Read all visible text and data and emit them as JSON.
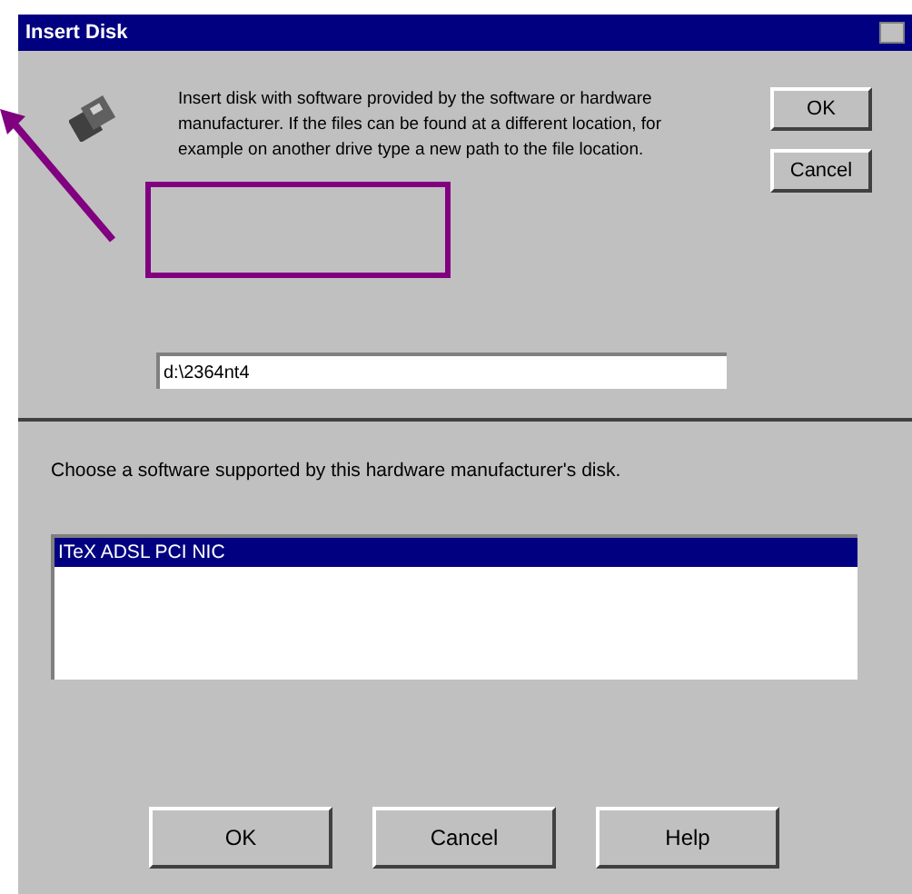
{
  "window": {
    "title": "Insert Disk"
  },
  "message": "Insert disk with software provided by the software or hardware manufacturer. If the files can be found at a different location, for example on another drive type a new path to the file location.",
  "side_buttons": [
    "OK",
    "Cancel"
  ],
  "path_field": {
    "value": "d:\\2364nt4"
  },
  "prompt": "Choose a software supported by this hardware manufacturer's disk.",
  "list": [
    {
      "label": "ITeX ADSL PCI NIC",
      "selected": true
    }
  ],
  "buttons": [
    "OK",
    "Cancel",
    "Help"
  ]
}
